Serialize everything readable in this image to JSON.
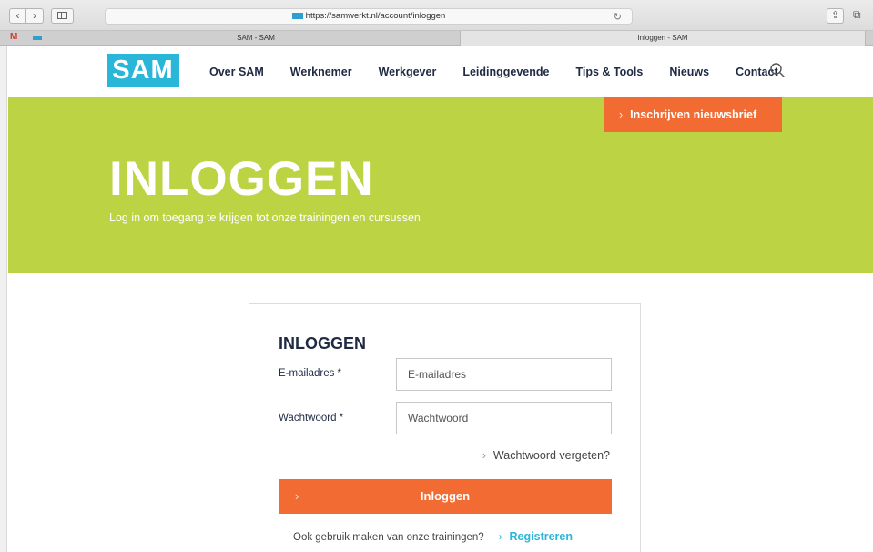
{
  "browser": {
    "url": "https://samwerkt.nl/account/inloggen",
    "back_glyph": "‹",
    "forward_glyph": "›",
    "reload_glyph": "↻",
    "share_glyph": "⇪",
    "tabs_glyph": "⧉",
    "tabs": [
      {
        "title": "SAM - SAM"
      },
      {
        "title": "Inloggen - SAM"
      }
    ]
  },
  "header": {
    "logo_text": "SAM",
    "nav": [
      "Over SAM",
      "Werknemer",
      "Werkgever",
      "Leidinggevende",
      "Tips & Tools",
      "Nieuws",
      "Contact"
    ]
  },
  "hero": {
    "newsletter_label": "Inschrijven nieuwsbrief",
    "title": "INLOGGEN",
    "subtitle": "Log in om toegang te krijgen tot onze trainingen en cursussen"
  },
  "login": {
    "title": "INLOGGEN",
    "email_label": "E-mailadres *",
    "email_placeholder": "E-mailadres",
    "password_label": "Wachtwoord *",
    "password_placeholder": "Wachtwoord",
    "forgot_label": "Wachtwoord vergeten?",
    "submit_label": "Inloggen",
    "register_prompt": "Ook gebruik maken van onze trainingen?",
    "register_label": "Registreren"
  },
  "colors": {
    "brand_blue": "#2ab6d9",
    "hero_green": "#bcd444",
    "cta_orange": "#f26b33",
    "navy_text": "#1f2a44"
  },
  "icons": {
    "chevron": "›"
  }
}
